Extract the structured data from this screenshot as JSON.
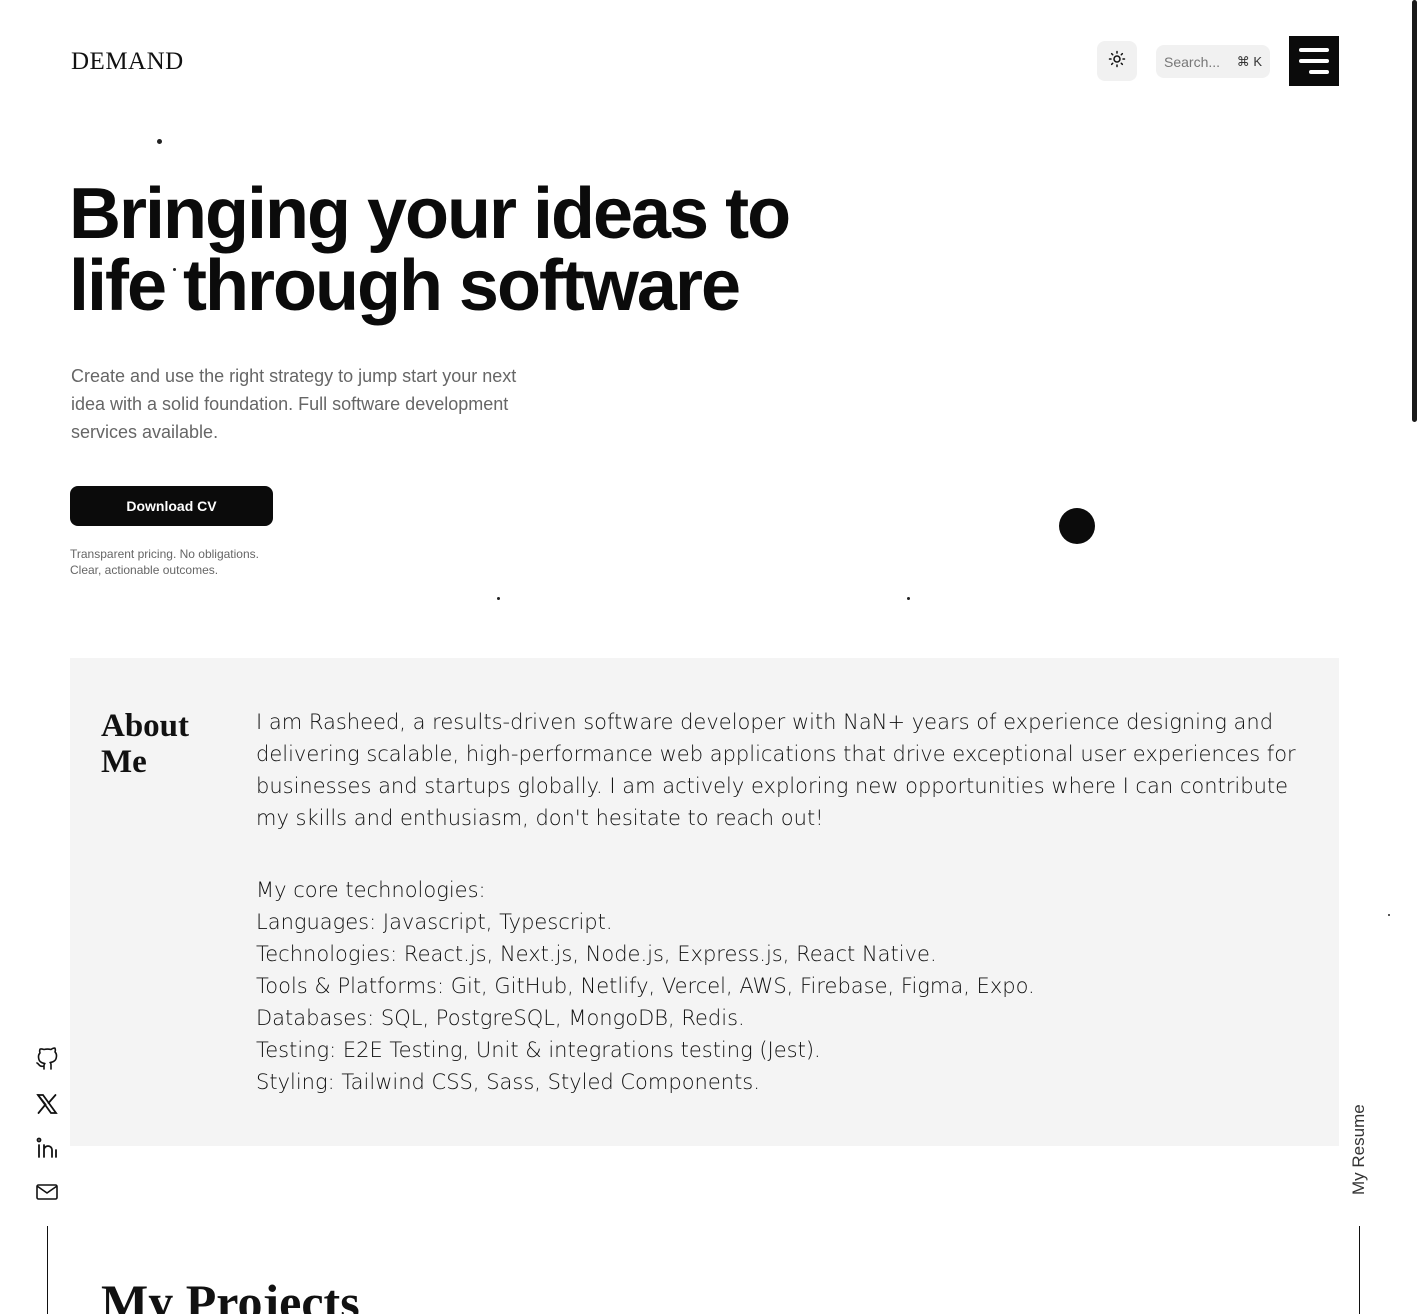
{
  "header": {
    "logo": "DEMAND",
    "theme_icon": "sun-icon",
    "search_placeholder": "Search...",
    "search_shortcut": "⌘ K",
    "menu_icon": "hamburger-menu-icon"
  },
  "hero": {
    "title_line1": "Bringing your ideas to",
    "title_line2": "life through software",
    "subtitle": "Create and use the right strategy to jump start your next idea with a solid foundation. Full software development services available.",
    "cta_label": "Download CV",
    "note_line1": "Transparent pricing. No obligations.",
    "note_line2": "Clear, actionable outcomes."
  },
  "about": {
    "title": "About Me",
    "intro": "I am Rasheed, a results-driven software developer with NaN+ years of experience designing and delivering scalable, high-performance web applications that drive exceptional user experiences for businesses and startups globally. I am actively exploring new opportunities where I can contribute my skills and enthusiasm, don't hesitate to reach out!",
    "tech_heading": "My core technologies:",
    "tech_lines": [
      "Languages: Javascript, Typescript.",
      "Technologies: React.js, Next.js, Node.js, Express.js, React Native.",
      "Tools & Platforms: Git, GitHub, Netlify, Vercel, AWS, Firebase, Figma, Expo.",
      "Databases: SQL, PostgreSQL, MongoDB, Redis.",
      "Testing: E2E Testing, Unit & integrations testing (Jest).",
      "Styling: Tailwind CSS, Sass, Styled Components."
    ]
  },
  "social": [
    "github-icon",
    "x-twitter-icon",
    "linkedin-icon",
    "mail-icon"
  ],
  "rail": {
    "resume_label": "My Resume"
  },
  "projects": {
    "title": "My Projects"
  }
}
